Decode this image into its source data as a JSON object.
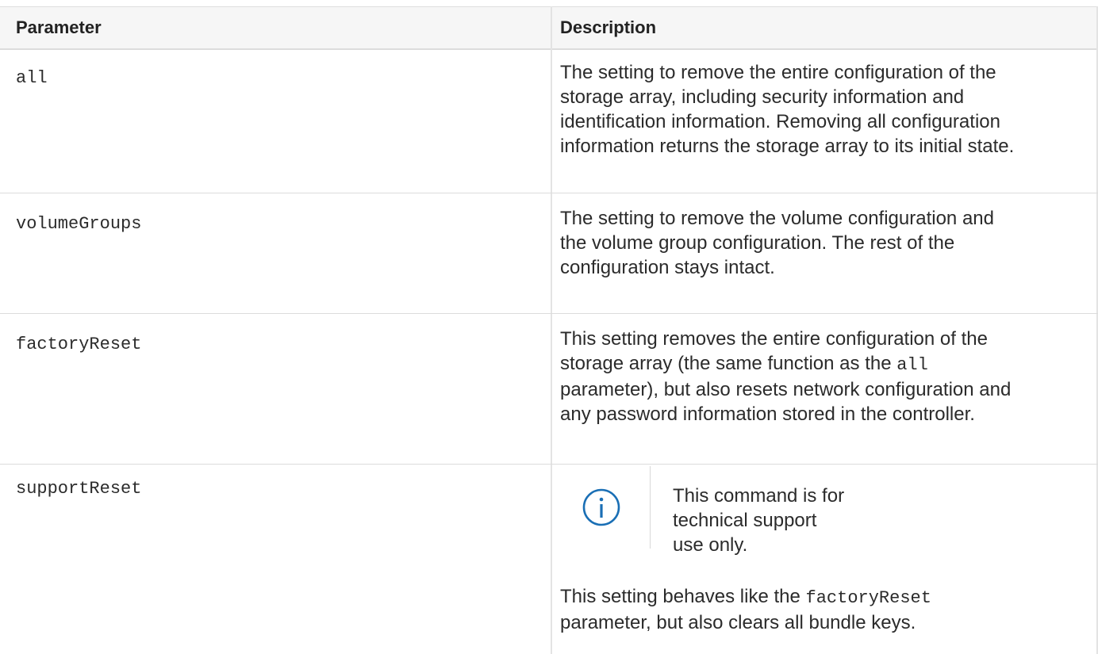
{
  "table": {
    "headers": {
      "parameter": "Parameter",
      "description": "Description"
    },
    "rows": [
      {
        "parameter": "all",
        "description_lines": [
          "The setting to remove the entire configuration of the",
          "storage array, including security information and",
          "identification information. Removing all configuration",
          "information returns the storage array to its initial state."
        ]
      },
      {
        "parameter": "volumeGroups",
        "description_lines": [
          "The setting to remove the volume configuration and",
          "the volume group configuration. The rest of the",
          "configuration stays intact."
        ]
      },
      {
        "parameter": "factoryReset",
        "description_line1": "This setting removes the entire configuration of the",
        "description_line2_pre": "storage array (the same function as the ",
        "description_line2_code": "all",
        "description_line3": "parameter), but also resets network configuration and",
        "description_line4": "any password information stored in the controller."
      },
      {
        "parameter": "supportReset",
        "note_icon": "info-icon",
        "note_line1": "This command is for technical support",
        "note_line2": "use only.",
        "description_line1_pre": "This setting behaves like the ",
        "description_line1_code": "factoryReset",
        "description_line2": "parameter, but also clears all bundle keys."
      }
    ]
  },
  "colors": {
    "info_icon": "#1a6fb5",
    "text": "#2b2b2b",
    "header_bg": "#f6f6f6"
  }
}
